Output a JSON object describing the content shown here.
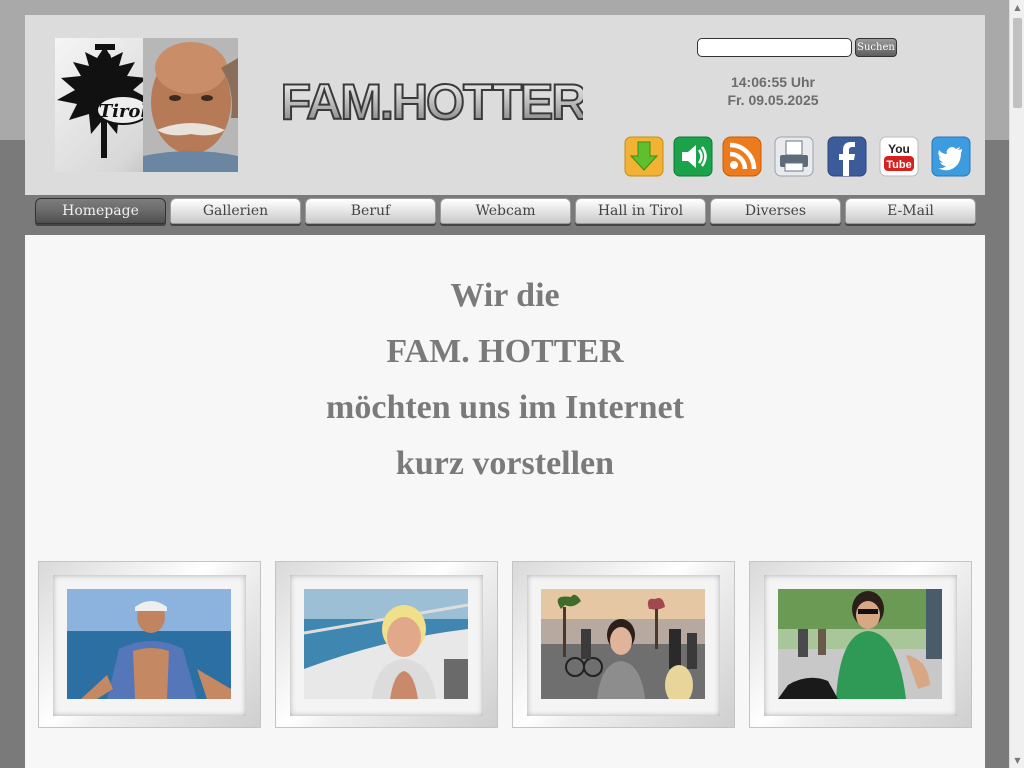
{
  "header": {
    "logo_text": "FAM.HOTTER",
    "search": {
      "placeholder": "",
      "button_label": "Suchen"
    },
    "clock": {
      "time": "14:06:55 Uhr",
      "date": "Fr. 09.05.2025"
    },
    "portrait_emblem_text": "Tirol",
    "social_icons": [
      "download-icon",
      "speaker-icon",
      "rss-icon",
      "print-icon",
      "facebook-icon",
      "youtube-icon",
      "twitter-icon"
    ],
    "youtube_icon_text": "You Tube"
  },
  "nav": {
    "tabs": [
      {
        "label": "Homepage",
        "active": true
      },
      {
        "label": "Gallerien"
      },
      {
        "label": "Beruf"
      },
      {
        "label": "Webcam"
      },
      {
        "label": "Hall in Tirol"
      },
      {
        "label": "Diverses"
      },
      {
        "label": "E-Mail"
      }
    ]
  },
  "main": {
    "intro_lines": [
      "Wir die",
      "FAM. HOTTER",
      "möchten uns im Internet",
      "kurz vorstellen"
    ]
  },
  "colors": {
    "page_bg_top": "#a9a9a9",
    "page_bg_bottom": "#7a7a7a",
    "header_bg": "#dcdcdc",
    "content_bg": "#f7f7f7",
    "text_gray": "#7a7a7a",
    "active_tab": "#6a6a6a"
  }
}
